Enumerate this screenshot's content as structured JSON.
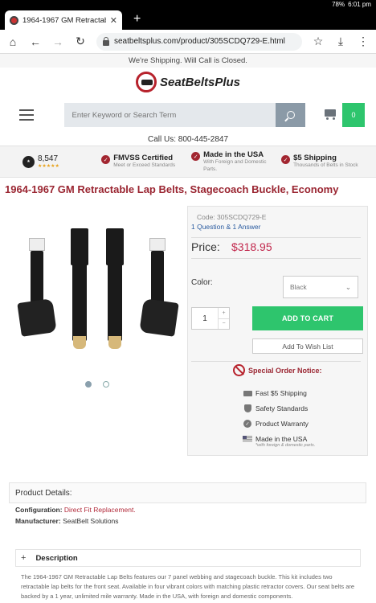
{
  "status_bar": {
    "battery": "78%",
    "time": "6:01 pm"
  },
  "browser": {
    "tab_title": "1964-1967 GM Retractable L",
    "new_tab_label": "+",
    "url": "seatbeltsplus.com/product/305SCDQ729-E.html"
  },
  "site": {
    "shipping_banner": "We're Shipping. Will Call is Closed.",
    "logo_text": "SeatBeltsPlus",
    "search_placeholder": "Enter Keyword or Search Term",
    "cart_count": "0",
    "call_us": "Call Us: 800-445-2847",
    "reviews_count": "8,547",
    "stars": "★★★★★",
    "trust_items": [
      {
        "title": "FMVSS Certified",
        "sub": "Meet or Exceed Standards"
      },
      {
        "title": "Made in the USA",
        "sub": "With Foreign and Domestic Parts."
      },
      {
        "title": "$5 Shipping",
        "sub": "Thousands of Belts in Stock"
      }
    ]
  },
  "product": {
    "title": "1964-1967 GM Retractable Lap Belts, Stagecoach Buckle, Economy",
    "code": "Code: 305SCDQ729-E",
    "qa": "1 Question & 1 Answer",
    "price_label": "Price:",
    "price": "$318.95",
    "color_label": "Color:",
    "color_value": "Black",
    "quantity": "1",
    "add_to_cart": "ADD TO CART",
    "wishlist": "Add To Wish List",
    "notice": "Special Order Notice:",
    "features": [
      {
        "icon": "truck-icon",
        "label": "Fast $5 Shipping"
      },
      {
        "icon": "shield-icon",
        "label": "Safety Standards"
      },
      {
        "icon": "checkmark-icon",
        "label": "Product Warranty"
      },
      {
        "icon": "flag-icon",
        "label": "Made in the USA"
      }
    ],
    "made_in_usa_sub": "*with foreign & domestic parts.",
    "details_heading": "Product Details:",
    "configuration_label": "Configuration:",
    "configuration_value": "Direct Fit Replacement.",
    "manufacturer_label": "Manufacturer:",
    "manufacturer_value": "SeatBelt Solutions",
    "description_label": "Description",
    "description_text": "The 1964-1967 GM Retractable Lap Belts features our 7 panel webbing and stagecoach buckle. This kit includes two retractable lap belts for the front seat. Available in four vibrant colors with matching plastic retractor covers. Our seat belts are backed by a 1 year, unlimited mile warranty. Made in the USA, with foreign and domestic components."
  },
  "gallery": {
    "slide_count": 2,
    "active_slide": 1
  }
}
